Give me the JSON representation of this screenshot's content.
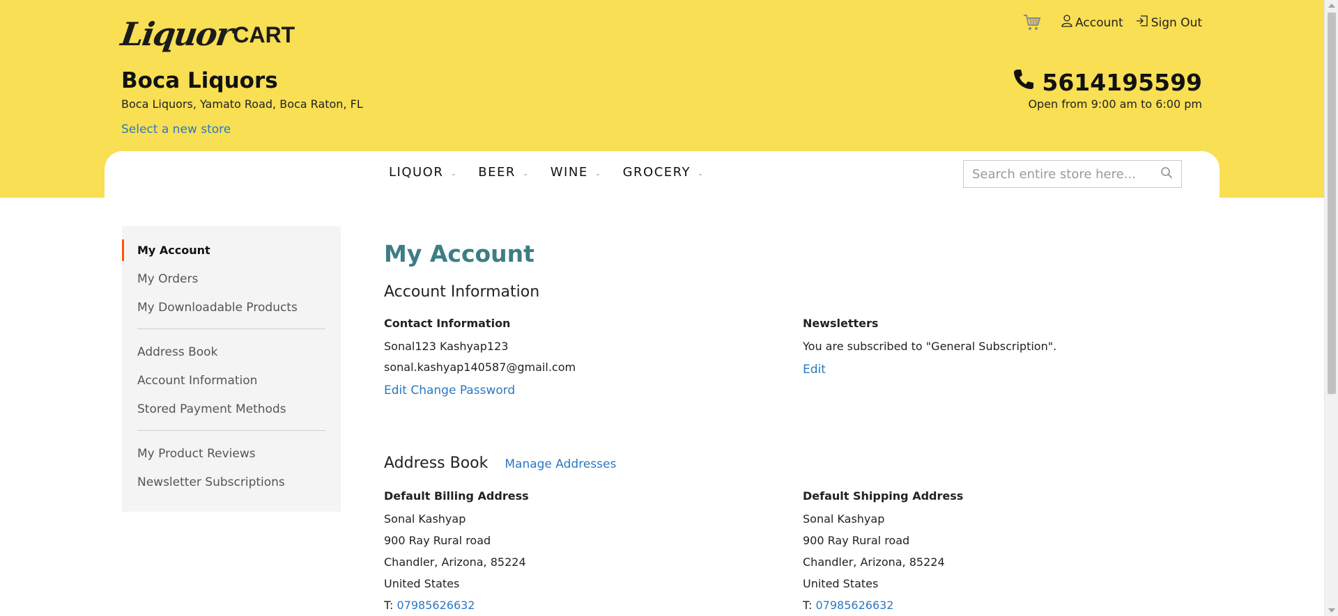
{
  "logo": {
    "script": "Liquor",
    "cart": "CART"
  },
  "top_links": {
    "account": "Account",
    "sign_out": "Sign Out"
  },
  "store": {
    "name": "Boca Liquors",
    "address": "Boca Liquors, Yamato Road, Boca Raton, FL",
    "select_link": "Select a new store",
    "phone": "5614195599",
    "hours": "Open from 9:00 am to 6:00 pm"
  },
  "nav": {
    "items": [
      "LIQUOR",
      "BEER",
      "WINE",
      "GROCERY"
    ]
  },
  "search": {
    "placeholder": "Search entire store here..."
  },
  "sidebar": {
    "items": [
      "My Account",
      "My Orders",
      "My Downloadable Products",
      "Address Book",
      "Account Information",
      "Stored Payment Methods",
      "My Product Reviews",
      "Newsletter Subscriptions"
    ]
  },
  "main": {
    "title": "My Account",
    "account_info": {
      "heading": "Account Information",
      "contact": {
        "title": "Contact Information",
        "name": "Sonal123 Kashyap123",
        "email": "sonal.kashyap140587@gmail.com",
        "edit": "Edit",
        "change_password": "Change Password"
      },
      "newsletters": {
        "title": "Newsletters",
        "text": "You are subscribed to \"General Subscription\".",
        "edit": "Edit"
      }
    },
    "address_book": {
      "heading": "Address Book",
      "manage": "Manage Addresses",
      "billing": {
        "title": "Default Billing Address",
        "name": "Sonal Kashyap",
        "street": "900 Ray Rural road",
        "city": "Chandler, Arizona, 85224",
        "country": "United States",
        "phone_label": "T:",
        "phone": "07985626632"
      },
      "shipping": {
        "title": "Default Shipping Address",
        "name": "Sonal Kashyap",
        "street": "900 Ray Rural road",
        "city": "Chandler, Arizona, 85224",
        "country": "United States",
        "phone_label": "T:",
        "phone": "07985626632"
      }
    }
  },
  "colors": {
    "header_bg": "#f8df53",
    "link": "#2a78c1",
    "title": "#3d7d85",
    "sidebar_bg": "#f4f4f4",
    "active_marker": "#ff5501"
  }
}
